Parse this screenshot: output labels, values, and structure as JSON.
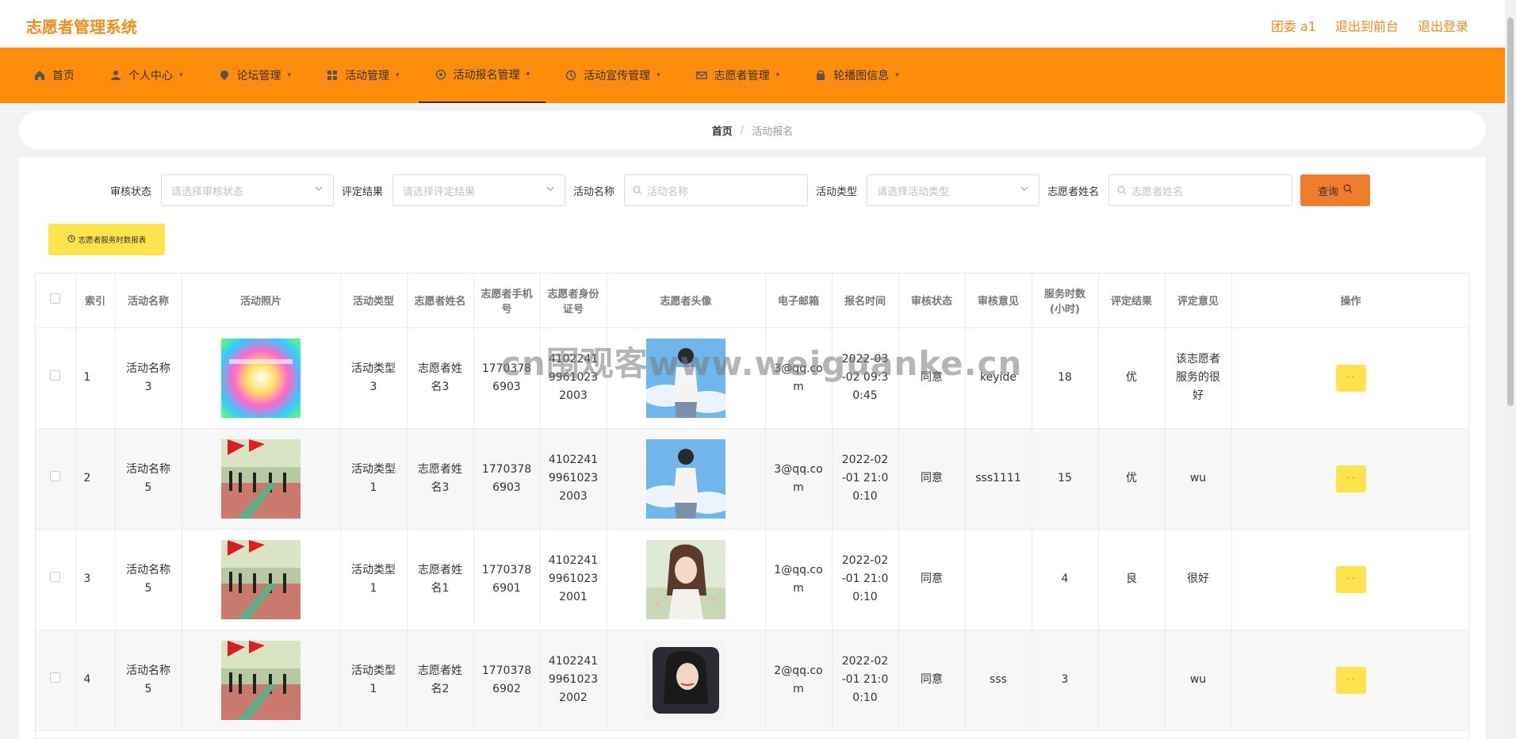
{
  "header": {
    "title": "志愿者管理系统",
    "user": "团委 a1",
    "to_front": "退出到前台",
    "logout": "退出登录"
  },
  "nav": {
    "items": [
      {
        "label": "首页",
        "icon": "home-icon",
        "caret": false
      },
      {
        "label": "个人中心",
        "icon": "user-icon",
        "caret": true
      },
      {
        "label": "论坛管理",
        "icon": "location-icon",
        "caret": true
      },
      {
        "label": "活动管理",
        "icon": "grid-icon",
        "caret": true
      },
      {
        "label": "活动报名管理",
        "icon": "circle-icon",
        "caret": true,
        "active": true
      },
      {
        "label": "活动宣传管理",
        "icon": "clock-icon",
        "caret": true
      },
      {
        "label": "志愿者管理",
        "icon": "mail-icon",
        "caret": true
      },
      {
        "label": "轮播图信息",
        "icon": "shop-icon",
        "caret": true
      }
    ]
  },
  "breadcrumb": {
    "home": "首页",
    "current": "活动报名"
  },
  "filters": {
    "audit_label": "审核状态",
    "audit_placeholder": "请选择审核状态",
    "eval_label": "评定结果",
    "eval_placeholder": "请选择评定结果",
    "activity_name_label": "活动名称",
    "activity_name_placeholder": "活动名称",
    "activity_type_label": "活动类型",
    "activity_type_placeholder": "请选择活动类型",
    "volunteer_label": "志愿者姓名",
    "volunteer_placeholder": "志愿者姓名",
    "query_button": "查询"
  },
  "report_button": "志愿者服务时数报表",
  "table": {
    "headers": [
      "索引",
      "活动名称",
      "活动照片",
      "活动类型",
      "志愿者姓名",
      "志愿者手机号",
      "志愿者身份证号",
      "志愿者头像",
      "电子邮箱",
      "报名时间",
      "审核状态",
      "审核意见",
      "服务时数(小时)",
      "评定结果",
      "评定意见",
      "操作"
    ],
    "rows": [
      {
        "index": "1",
        "activity_name": "活动名称3",
        "activity_type": "活动类型3",
        "volunteer_name": "志愿者姓名3",
        "phone": "17703786903",
        "id_card": "410224199610232003",
        "email": "3@qq.com",
        "time": "2022-03-02 09:30:45",
        "audit": "同意",
        "audit_opinion": "keyide",
        "hours": "18",
        "eval_result": "优",
        "eval_opinion": "该志愿者服务的很好",
        "photo": "colorful",
        "avatar": "boy"
      },
      {
        "index": "2",
        "activity_name": "活动名称5",
        "activity_type": "活动类型1",
        "volunteer_name": "志愿者姓名3",
        "phone": "17703786903",
        "id_card": "410224199610232003",
        "email": "3@qq.com",
        "time": "2022-02-01 21:00:10",
        "audit": "同意",
        "audit_opinion": "sss1111",
        "hours": "15",
        "eval_result": "优",
        "eval_opinion": "wu",
        "photo": "flags",
        "avatar": "boy"
      },
      {
        "index": "3",
        "activity_name": "活动名称5",
        "activity_type": "活动类型1",
        "volunteer_name": "志愿者姓名1",
        "phone": "17703786901",
        "id_card": "410224199610232001",
        "email": "1@qq.com",
        "time": "2022-02-01 21:00:10",
        "audit": "同意",
        "audit_opinion": "",
        "hours": "4",
        "eval_result": "良",
        "eval_opinion": "很好",
        "photo": "flags",
        "avatar": "girl"
      },
      {
        "index": "4",
        "activity_name": "活动名称5",
        "activity_type": "活动类型1",
        "volunteer_name": "志愿者姓名2",
        "phone": "17703786902",
        "id_card": "410224199610232002",
        "email": "2@qq.com",
        "time": "2022-02-01 21:00:10",
        "audit": "同意",
        "audit_opinion": "sss",
        "hours": "3",
        "eval_result": "",
        "eval_opinion": "wu",
        "photo": "flags",
        "avatar": "woman"
      }
    ]
  },
  "watermark": "cn围观客www.weiguanke.cn",
  "colors": {
    "accent": "#ff8c0a",
    "title": "#f28c1a",
    "query": "#f07c2c",
    "yellow": "#ffe34d"
  }
}
